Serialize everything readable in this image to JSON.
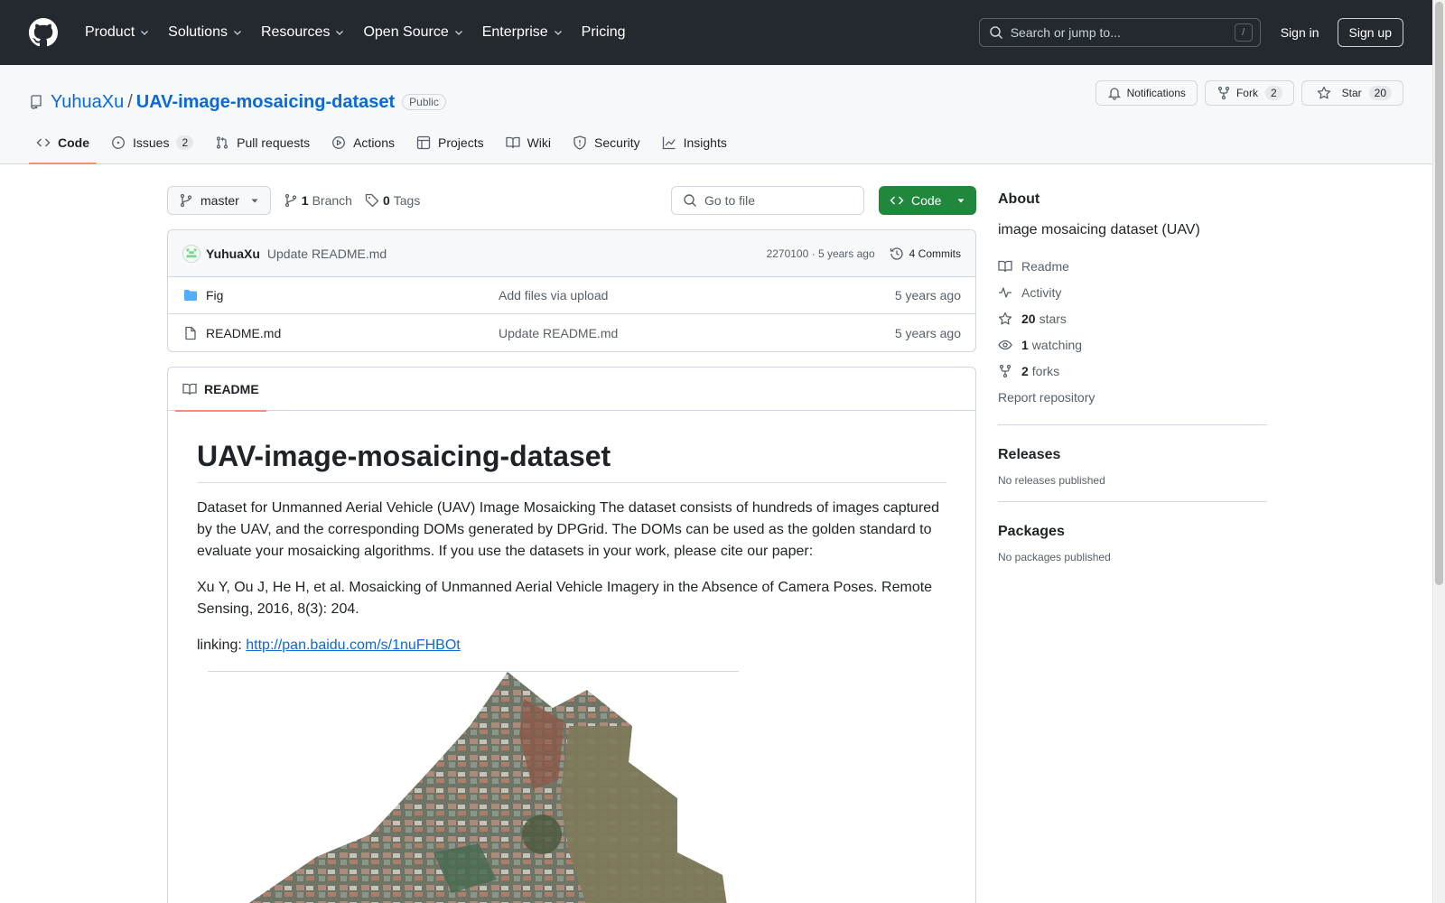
{
  "header": {
    "nav": [
      {
        "label": "Product",
        "has_menu": true
      },
      {
        "label": "Solutions",
        "has_menu": true
      },
      {
        "label": "Resources",
        "has_menu": true
      },
      {
        "label": "Open Source",
        "has_menu": true
      },
      {
        "label": "Enterprise",
        "has_menu": true
      },
      {
        "label": "Pricing",
        "has_menu": false
      }
    ],
    "search_placeholder": "Search or jump to...",
    "search_key": "/",
    "sign_in": "Sign in",
    "sign_up": "Sign up"
  },
  "repo": {
    "owner": "YuhuaXu",
    "separator": "/",
    "name": "UAV-image-mosaicing-dataset",
    "visibility": "Public",
    "notifications_label": "Notifications",
    "fork_label": "Fork",
    "fork_count": "2",
    "star_label": "Star",
    "star_count": "20",
    "tabs": [
      {
        "label": "Code",
        "icon": "code-icon",
        "count": ""
      },
      {
        "label": "Issues",
        "icon": "issue-icon",
        "count": "2"
      },
      {
        "label": "Pull requests",
        "icon": "pull-request-icon",
        "count": ""
      },
      {
        "label": "Actions",
        "icon": "play-icon",
        "count": ""
      },
      {
        "label": "Projects",
        "icon": "table-icon",
        "count": ""
      },
      {
        "label": "Wiki",
        "icon": "book-icon",
        "count": ""
      },
      {
        "label": "Security",
        "icon": "shield-icon",
        "count": ""
      },
      {
        "label": "Insights",
        "icon": "graph-icon",
        "count": ""
      }
    ]
  },
  "toolbar": {
    "branch": "master",
    "branch_count": "1",
    "branch_label": "Branch",
    "tag_count": "0",
    "tag_label": "Tags",
    "goto_file_placeholder": "Go to file",
    "code_button": "Code"
  },
  "latest_commit": {
    "author": "YuhuaXu",
    "message": "Update README.md",
    "hash_time": "2270100 · 5 years ago",
    "commits_label": "4 Commits"
  },
  "files": [
    {
      "name": "Fig",
      "type": "folder",
      "commit": "Add files via upload",
      "age": "5 years ago"
    },
    {
      "name": "README.md",
      "type": "file",
      "commit": "Update README.md",
      "age": "5 years ago"
    }
  ],
  "readme": {
    "tab_label": "README",
    "title": "UAV-image-mosaicing-dataset",
    "paragraph1": "Dataset for Unmanned Aerial Vehicle (UAV) Image Mosaicking The dataset  consists of hundreds of images captured by the UAV, and the corresponding DOMs generated by DPGrid. The DOMs can be used as the golden standard to evaluate your mosaicking algorithms. If you use the datasets in your work, please cite our paper:",
    "paragraph2": "Xu Y, Ou J, He H, et al. Mosaicking of Unmanned Aerial Vehicle Imagery in the Absence of Camera Poses. Remote Sensing, 2016, 8(3): 204.",
    "link_prefix": "linking: ",
    "link_text": "http://pan.baidu.com/s/1nuFHBOt"
  },
  "about": {
    "heading": "About",
    "description": "image mosaicing dataset (UAV)",
    "readme": "Readme",
    "activity": "Activity",
    "stars_count": "20",
    "stars_label": "stars",
    "watching_count": "1",
    "watching_label": "watching",
    "forks_count": "2",
    "forks_label": "forks",
    "report": "Report repository"
  },
  "releases": {
    "heading": "Releases",
    "empty": "No releases published"
  },
  "packages": {
    "heading": "Packages",
    "empty": "No packages published"
  },
  "colors": {
    "header_bg": "#24292f",
    "link": "#0969da",
    "code_button": "#1f883d",
    "active_tab": "#fd8c73",
    "folder": "#54aeff"
  }
}
